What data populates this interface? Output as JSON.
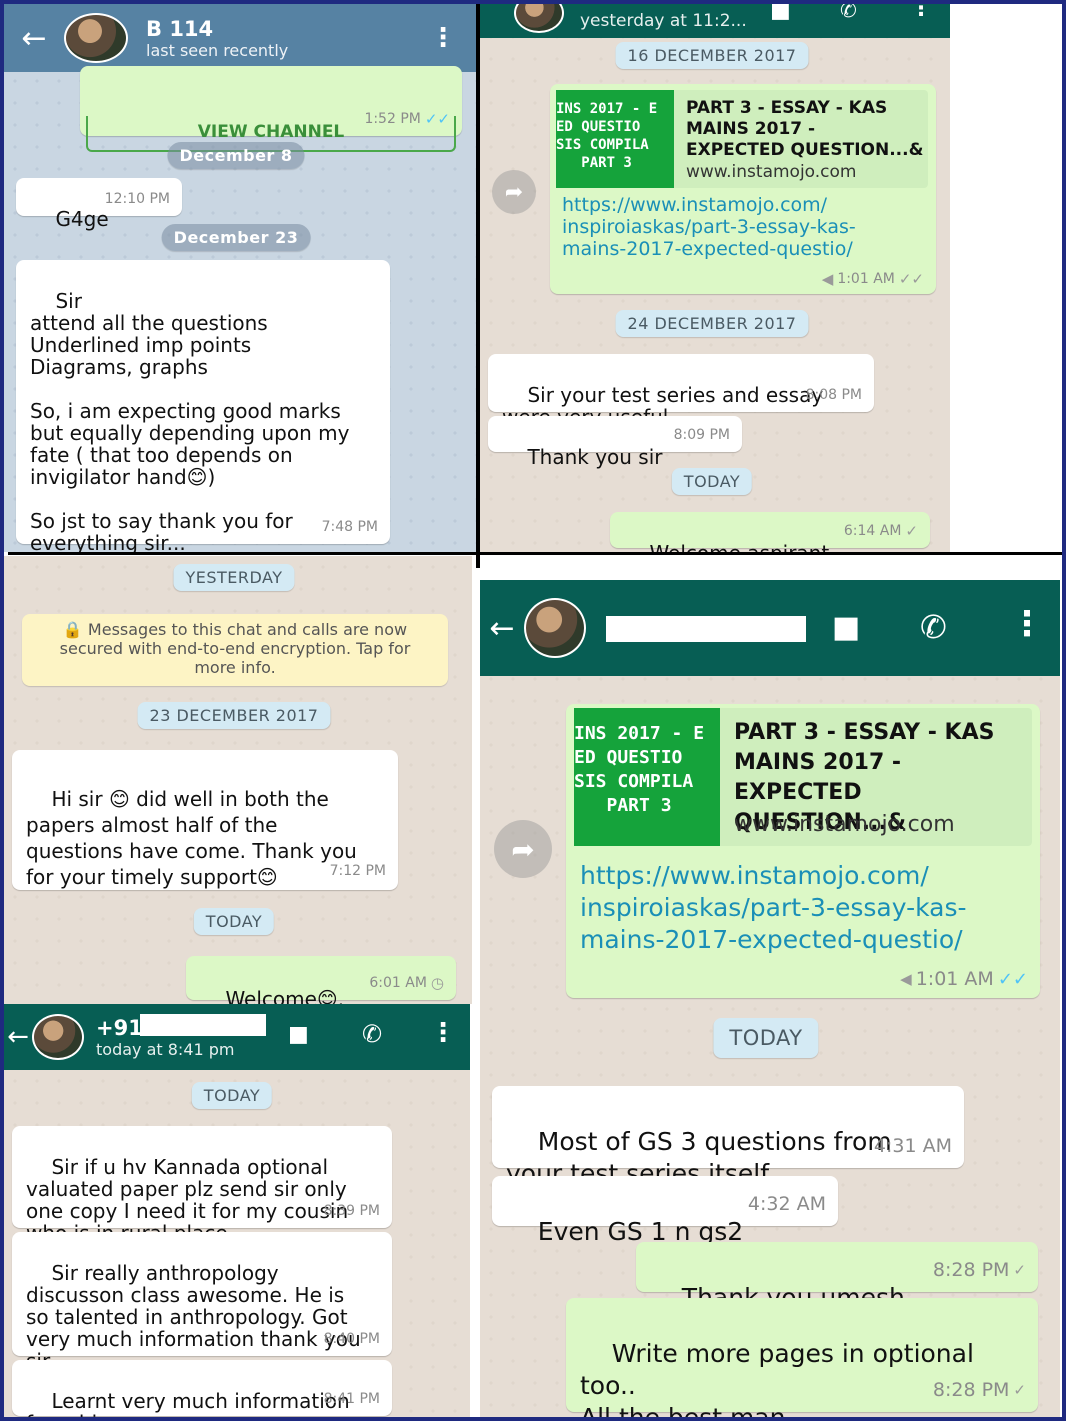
{
  "p1": {
    "title": "B 114",
    "status": "last seen recently",
    "view_channel": "VIEW CHANNEL",
    "top_time": "1:52 PM",
    "date1": "December 8",
    "msg1": "G4ge",
    "msg1_time": "12:10 PM",
    "date2": "December 23",
    "msg2": "Sir\nattend all the questions\nUnderlined imp points\nDiagrams, graphs\n\nSo, i am expecting good marks\nbut equally depending upon my\nfate ( that too depends on\ninvigilator hand😊)\n\nSo jst to say thank you for\neverything sir...",
    "msg2_time": "7:48 PM"
  },
  "p2": {
    "header_status": "yesterday at 11:2...",
    "date1": "16 DECEMBER 2017",
    "thumb": "INS 2017 - E\nED QUESTIO\nSIS COMPILA\n   PART 3",
    "preview_title": "PART 3 - ESSAY - KAS\nMAINS 2017 -\nEXPECTED QUESTION...&",
    "preview_domain": "www.instamojo.com",
    "link": "https://www.instamojo.com/\ninspiroiaskas/part-3-essay-kas-\nmains-2017-expected-questio/",
    "link_time": "1:01 AM",
    "date2": "24 DECEMBER 2017",
    "msg1": "Sir your test series and essay\nwere very useful",
    "msg1_time": "8:08 PM",
    "msg2": "Thank you sir",
    "msg2_time": "8:09 PM",
    "date3": "TODAY",
    "reply": "Welcome aspirant",
    "reply_time": "6:14 AM"
  },
  "p3": {
    "date1": "YESTERDAY",
    "encryption": "🔒 Messages to this chat and calls are now\nsecured with end-to-end encryption. Tap for\nmore info.",
    "date2": "23 DECEMBER 2017",
    "msg1": "Hi sir 😊 did well in both the\npapers almost half of the\nquestions have come. Thank you\nfor your timely support😊",
    "msg1_time": "7:12 PM",
    "date3": "TODAY",
    "reply": "Welcome😊.",
    "reply_time": "6:01 AM"
  },
  "p4": {
    "title": "+91",
    "status": "today at 8:41 pm",
    "date1": "TODAY",
    "msg1": "Sir if u hv Kannada optional\nvaluated paper plz send sir only\none copy I need it for my cousin\nwho is in rural place.",
    "msg1_time": "8:39 PM",
    "msg2": "Sir really anthropology\ndiscusson class awesome. He is\nso talented in anthropology. Got\nvery much information thank you\nsir",
    "msg2_time": "8:40 PM",
    "msg3": "Learnt very much information\nfrom him",
    "msg3_time": "8:41 PM"
  },
  "p5": {
    "thumb": "INS 2017 - E\nED QUESTIO\nSIS COMPILA\n   PART 3",
    "preview_title": "PART 3 - ESSAY - KAS\nMAINS 2017 -\nEXPECTED QUESTION...&",
    "preview_domain": "www.instamojo.com",
    "link": "https://www.instamojo.com/\ninspiroiaskas/part-3-essay-kas-\nmains-2017-expected-questio/",
    "link_time": "1:01 AM",
    "date1": "TODAY",
    "msg1": "Most of GS 3 questions from\nyour test series itself",
    "msg1_time": "4:31 AM",
    "msg2": "Even GS 1 n gs2",
    "msg2_time": "4:32 AM",
    "reply1": "Thank you umesh.",
    "reply1_time": "8:28 PM",
    "reply2": "Write more pages in optional\ntoo..\nAll the best man.",
    "reply2_time": "8:28 PM"
  },
  "icons": {
    "back": "arrow-left-icon",
    "menu": "kebab-menu-icon",
    "video": "video-call-icon",
    "call": "phone-icon",
    "forward": "forward-icon",
    "tick": "double-tick-icon"
  },
  "colors": {
    "header_green": "#075e54",
    "header_blue": "#5682a3",
    "out_bubble": "#dcf8c6",
    "in_bubble": "#ffffff"
  }
}
